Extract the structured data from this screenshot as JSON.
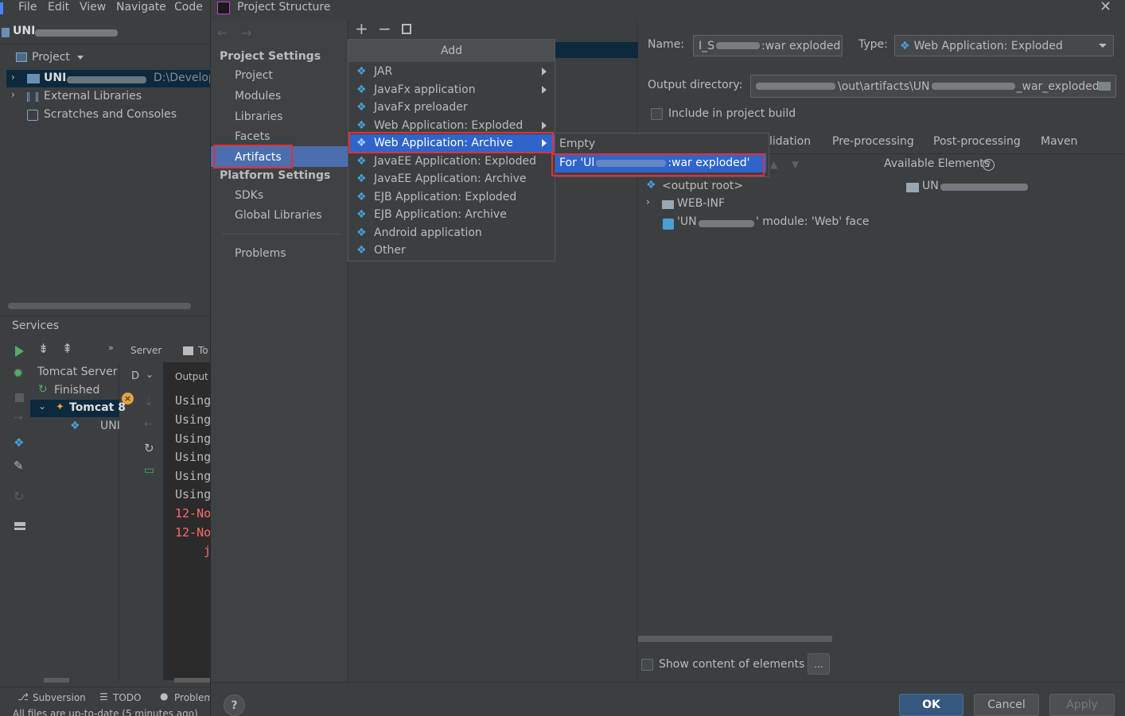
{
  "menubar": {
    "items": [
      "File",
      "Edit",
      "View",
      "Navigate",
      "Code"
    ]
  },
  "project": {
    "name_prefix": "UNI",
    "view_selector": "Project",
    "tree": {
      "module_prefix": "UNI",
      "module_path": "D:\\Develop",
      "external_libraries": "External Libraries",
      "scratches": "Scratches and Consoles"
    }
  },
  "services": {
    "title": "Services",
    "server_tab": "Server",
    "to_tab": "To",
    "tomcat_server": "Tomcat Server",
    "finished": "Finished",
    "tomcat_instance": "Tomcat 8",
    "artifact_prefix": "UNI",
    "deploy_label": "D",
    "output_label": "Output",
    "output_lines": [
      "Using",
      "Using",
      "Using",
      "Using",
      "Using",
      "Using"
    ],
    "error_lines": [
      "12-No",
      "12-No"
    ],
    "error_tail": "j"
  },
  "status_bar": {
    "subversion": "Subversion",
    "todo": "TODO",
    "problems": "Problem",
    "message": "All files are up-to-date (5 minutes ago)"
  },
  "dialog": {
    "title": "Project Structure",
    "project_settings_heading": "Project Settings",
    "project_settings_items": [
      "Project",
      "Modules",
      "Libraries",
      "Facets",
      "Artifacts"
    ],
    "platform_settings_heading": "Platform Settings",
    "platform_settings_items": [
      "SDKs",
      "Global Libraries"
    ],
    "problems": "Problems",
    "selected_nav": "Artifacts"
  },
  "add_popup": {
    "title": "Add",
    "items": [
      "JAR",
      "JavaFx application",
      "JavaFx preloader",
      "Web Application: Exploded",
      "Web Application: Archive",
      "JavaEE Application: Exploded",
      "JavaEE Application: Archive",
      "EJB Application: Exploded",
      "EJB Application: Archive",
      "Android application",
      "Other"
    ],
    "selected": "Web Application: Archive"
  },
  "submenu": {
    "items": [
      "Empty",
      "For 'UN",
      ":war exploded'"
    ],
    "empty": "Empty",
    "for_prefix": "For 'Ul",
    "for_suffix": ":war exploded'"
  },
  "artifact_form": {
    "name_label": "Name:",
    "name_prefix": "I_S",
    "name_suffix": ":war exploded",
    "type_label": "Type:",
    "type_value": "Web Application: Exploded",
    "output_dir_label": "Output directory:",
    "output_dir_mid": "\\out\\artifacts\\UN",
    "output_dir_suffix": "_war_exploded",
    "include_in_build": "Include in project build",
    "tabs": [
      "lidation",
      "Pre-processing",
      "Post-processing",
      "Maven"
    ],
    "available_elements": "Available Elements",
    "output_root": "<output root>",
    "web_inf": "WEB-INF",
    "module_prefix": "'UN",
    "module_suffix": "' module: 'Web' face",
    "avail_prefix": "UN",
    "show_content": "Show content of elements",
    "ellipsis": "..."
  },
  "buttons": {
    "ok": "OK",
    "cancel": "Cancel",
    "apply": "Apply",
    "help": "?"
  },
  "colors": {
    "selection": "#2f65ca",
    "highlight_red": "#e0313a",
    "ok": "#365880",
    "error_text": "#ff6b68"
  }
}
